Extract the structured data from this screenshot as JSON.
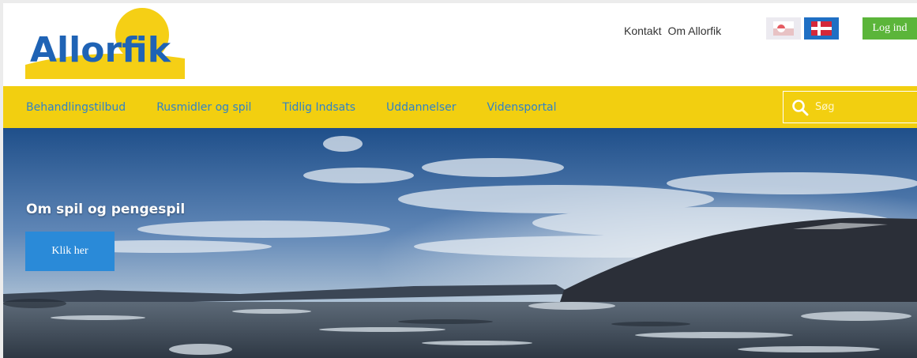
{
  "header": {
    "logo_text": "Allorfik",
    "top_links": [
      "Kontakt",
      "Om Allorfik"
    ],
    "login_label": "Log ind"
  },
  "nav": {
    "items": [
      "Behandlingstilbud",
      "Rusmidler og spil",
      "Tidlig Indsats",
      "Uddannelser",
      "Vidensportal"
    ],
    "search_placeholder": "Søg"
  },
  "hero": {
    "title": "Om spil og pengespil",
    "button_label": "Klik her"
  },
  "colors": {
    "nav_bg": "#f2cf10",
    "nav_text": "#2f82c8",
    "login_bg": "#5bb53a",
    "hero_button": "#2a8ad8",
    "logo_blue": "#1f63b5",
    "logo_yellow": "#f5cf15"
  },
  "icons": [
    "search-icon",
    "greenland-flag-icon",
    "denmark-flag-icon"
  ]
}
